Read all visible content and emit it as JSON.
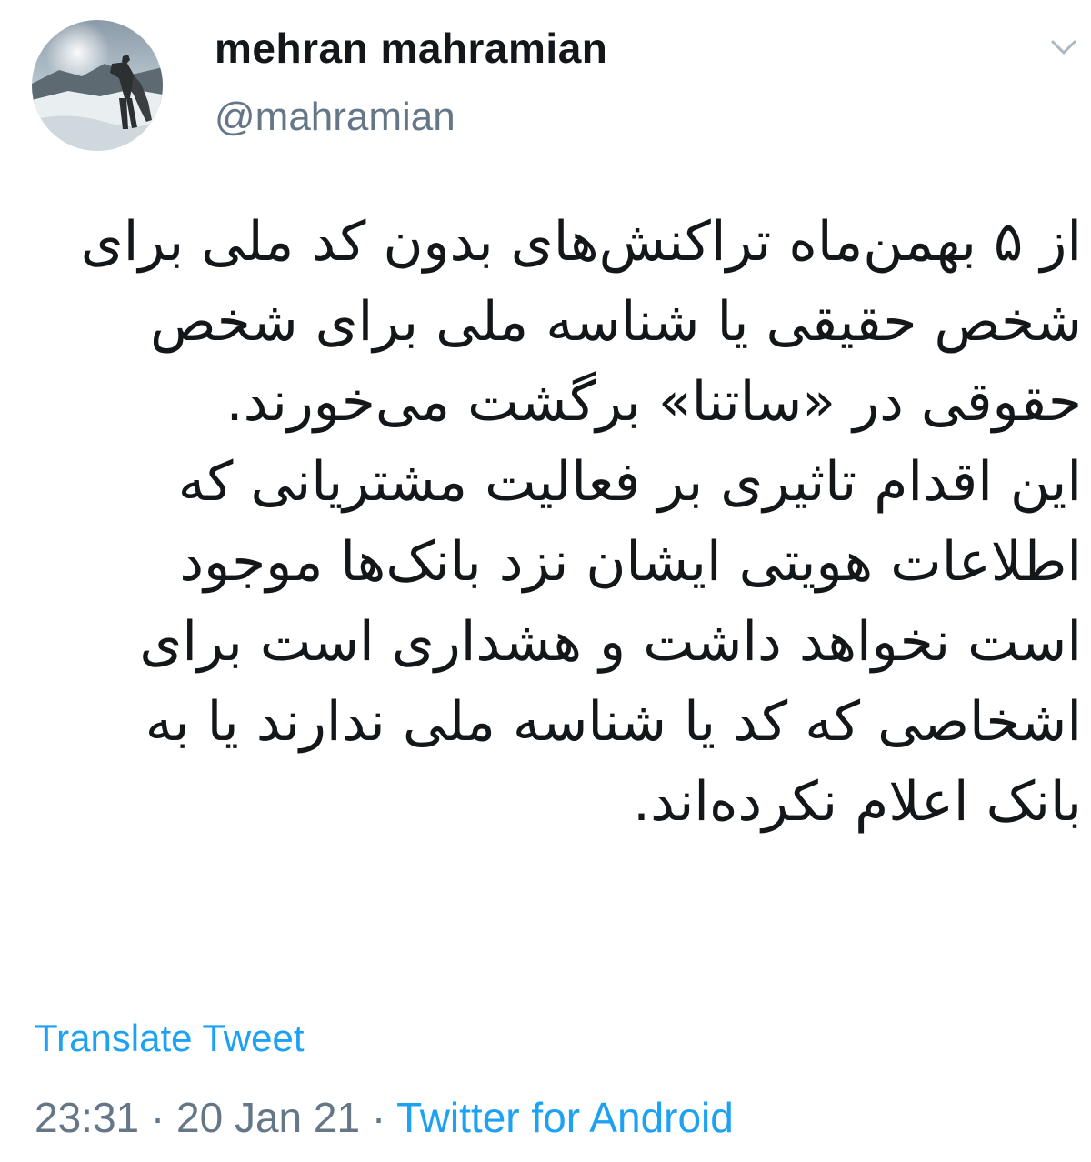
{
  "user": {
    "display_name": "mehran mahramian",
    "handle": "@mahramian",
    "avatar_icon": "profile-photo-snowy-hiker"
  },
  "menu": {
    "icon": "chevron-down-icon"
  },
  "tweet": {
    "lines": [
      "از ۵ بهمن‌ماه تراکنش‌های بدون کد ملی برای",
      "شخص حقیقی یا شناسه ملی برای شخص",
      "حقوقی در «ساتنا» برگشت می‌خورند.",
      "این اقدام تاثیری بر فعالیت مشتریانی که",
      "اطلاعات هویتی ایشان نزد بانک‌ها موجود",
      "است نخواهد داشت و هشداری است برای",
      "اشخاصی که کد یا شناسه ملی ندارند یا به",
      "بانک اعلام نکرده‌اند."
    ]
  },
  "translate_label": "Translate Tweet",
  "meta": {
    "time": "23:31",
    "separator": " · ",
    "date": "20 Jan 21",
    "source": "Twitter for Android"
  },
  "colors": {
    "text": "#14171a",
    "secondary": "#657786",
    "link": "#1da1f2"
  }
}
